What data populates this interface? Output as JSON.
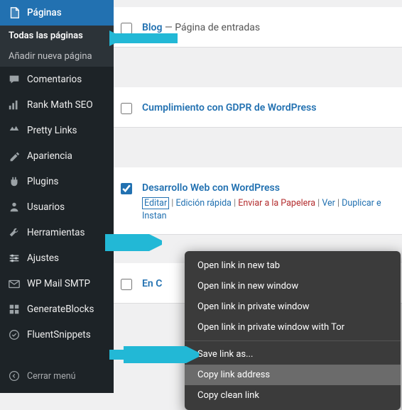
{
  "sidebar": {
    "paginas": "Páginas",
    "sub": {
      "todas": "Todas las páginas",
      "anadir": "Añadir nueva página"
    },
    "comentarios": "Comentarios",
    "rankmath": "Rank Math SEO",
    "prettylinks": "Pretty Links",
    "apariencia": "Apariencia",
    "plugins": "Plugins",
    "usuarios": "Usuarios",
    "herramientas": "Herramientas",
    "ajustes": "Ajustes",
    "wpmail": "WP Mail SMTP",
    "generateblocks": "GenerateBlocks",
    "fluentsnippets": "FluentSnippets",
    "cerrar": "Cerrar menú"
  },
  "pages": [
    {
      "title": "Blog",
      "suffix": " — Página de entradas",
      "checked": false
    },
    {
      "title": "Cumplimiento con GDPR de WordPress",
      "suffix": "",
      "checked": false
    },
    {
      "title": "Desarrollo Web con WordPress",
      "suffix": "",
      "checked": true
    },
    {
      "title": "En C",
      "suffix": "",
      "checked": false
    }
  ],
  "rowactions": {
    "editar": "Editar",
    "rapida": "Edición rápida",
    "papelera": "Enviar a la Papelera",
    "ver": "Ver",
    "duplicar": "Duplicar e",
    "instan": "Instan"
  },
  "context": {
    "newtab": "Open link in new tab",
    "newwin": "Open link in new window",
    "private": "Open link in private window",
    "privatetor": "Open link in private window with Tor",
    "saveas": "Save link as...",
    "copyaddr": "Copy link address",
    "copyclean": "Copy clean link"
  }
}
